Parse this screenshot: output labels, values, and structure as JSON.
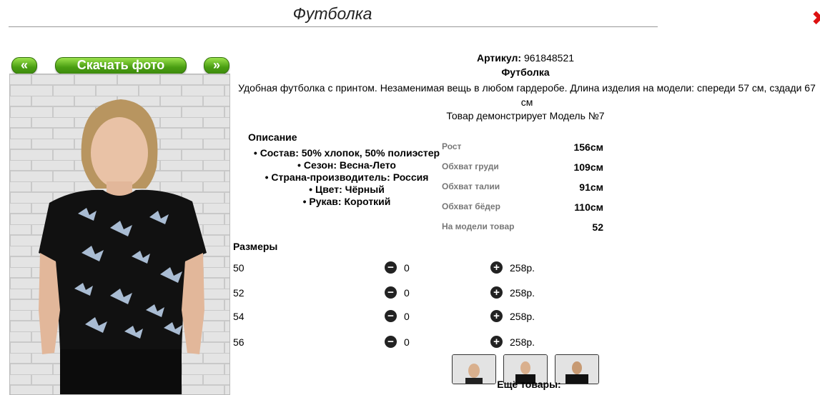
{
  "title": "Футболка",
  "nav": {
    "prev": "«",
    "download": "Скачать фото",
    "next": "»"
  },
  "article_label": "Артикул:",
  "article_value": "961848521",
  "product_name": "Футболка",
  "description": "Удобная футболка с принтом. Незаменимая вещь в любом гардеробе. Длина изделия на модели: спереди 57 см, сздади 67 см",
  "model_note": "Товар демонстрирует Модель №7",
  "opisanie": {
    "heading": "Описание",
    "items": [
      "Состав: 50% хлопок, 50% полиэстер",
      "Сезон: Весна-Лето",
      "Страна-производитель: Россия",
      "Цвет: Чёрный",
      "Рукав: Короткий"
    ]
  },
  "measurements": [
    {
      "label": "Рост",
      "value": "156см"
    },
    {
      "label": "Обхват груди",
      "value": "109см"
    },
    {
      "label": "Обхват талии",
      "value": "91см"
    },
    {
      "label": "Обхват бёдер",
      "value": "110см"
    },
    {
      "label": "На модели товар",
      "value": "52"
    }
  ],
  "sizes_heading": "Размеры",
  "sizes": [
    {
      "size": "50",
      "qty": "0",
      "price": "258р."
    },
    {
      "size": "52",
      "qty": "0",
      "price": "258р."
    },
    {
      "size": "54",
      "qty": "0",
      "price": "258р."
    },
    {
      "size": "56",
      "qty": "0",
      "price": "258р."
    }
  ],
  "more_products": "Ещё товары:",
  "icons": {
    "minus": "minus-circle-icon",
    "plus": "plus-circle-icon",
    "close": "close-icon"
  },
  "colors": {
    "button_green": "#4a9e12",
    "close_red": "#dd1111"
  }
}
